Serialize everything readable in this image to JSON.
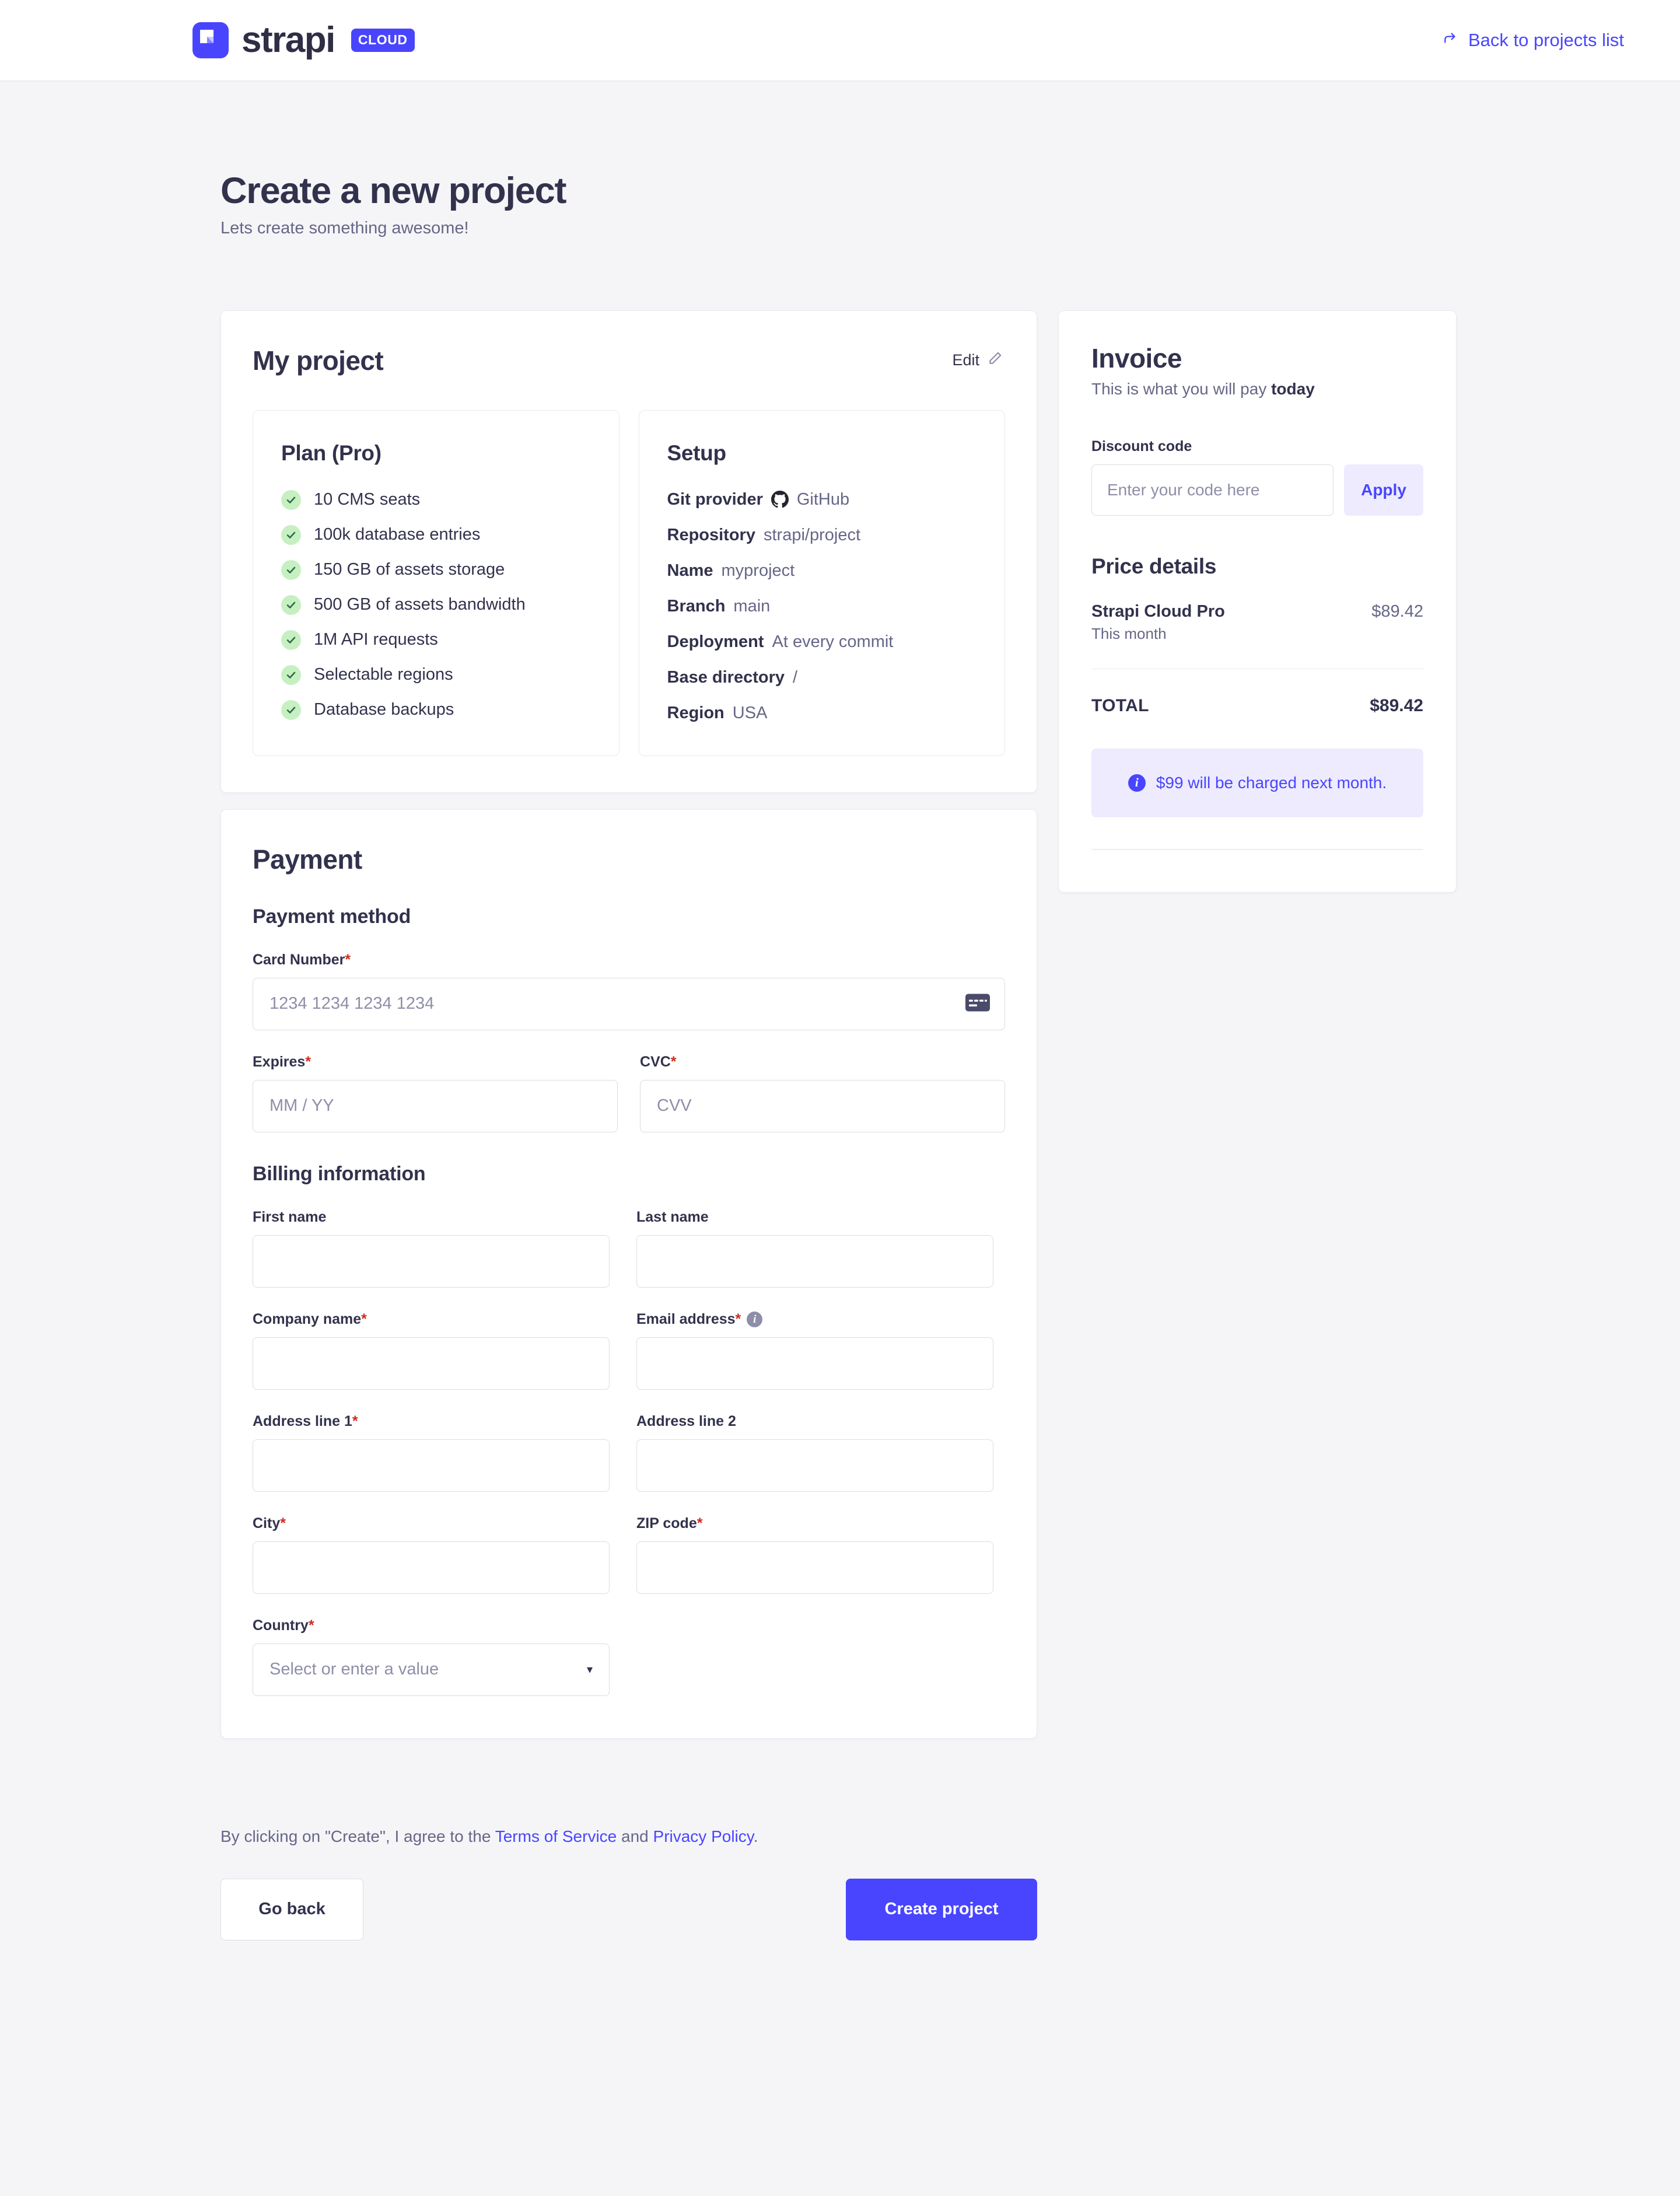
{
  "header": {
    "brand_word": "strapi",
    "brand_badge": "CLOUD",
    "back_link": "Back to projects list"
  },
  "page": {
    "title": "Create a new project",
    "subtitle": "Lets create something awesome!"
  },
  "project": {
    "name": "My project",
    "edit_label": "Edit",
    "plan": {
      "title": "Plan (Pro)",
      "features": [
        "10 CMS seats",
        "100k database entries",
        "150 GB of assets storage",
        "500 GB of assets bandwidth",
        "1M API requests",
        "Selectable regions",
        "Database backups"
      ]
    },
    "setup": {
      "title": "Setup",
      "rows": [
        {
          "key": "Git provider",
          "value": "GitHub",
          "icon": "github-icon"
        },
        {
          "key": "Repository",
          "value": "strapi/project"
        },
        {
          "key": "Name",
          "value": "myproject"
        },
        {
          "key": "Branch",
          "value": "main"
        },
        {
          "key": "Deployment",
          "value": "At every commit"
        },
        {
          "key": "Base directory",
          "value": "/"
        },
        {
          "key": "Region",
          "value": "USA"
        }
      ]
    }
  },
  "payment": {
    "title": "Payment",
    "method_title": "Payment method",
    "card_number": {
      "label": "Card Number",
      "required": "*",
      "placeholder": "1234 1234 1234 1234",
      "value": ""
    },
    "expires": {
      "label": "Expires",
      "required": "*",
      "placeholder": "MM / YY",
      "value": ""
    },
    "cvc": {
      "label": "CVC",
      "required": "*",
      "placeholder": "CVV",
      "value": ""
    },
    "billing_title": "Billing information",
    "first_name": {
      "label": "First name",
      "required": "",
      "placeholder": "",
      "value": ""
    },
    "last_name": {
      "label": "Last name",
      "required": "",
      "placeholder": "",
      "value": ""
    },
    "company_name": {
      "label": "Company name",
      "required": "*",
      "placeholder": "",
      "value": ""
    },
    "email": {
      "label": "Email address",
      "required": "*",
      "placeholder": "",
      "value": "",
      "info": "i"
    },
    "address1": {
      "label": "Address line 1",
      "required": "*",
      "placeholder": "",
      "value": ""
    },
    "address2": {
      "label": "Address line 2",
      "required": "",
      "placeholder": "",
      "value": ""
    },
    "city": {
      "label": "City",
      "required": "*",
      "placeholder": "",
      "value": ""
    },
    "zip": {
      "label": "ZIP code",
      "required": "*",
      "placeholder": "",
      "value": ""
    },
    "country": {
      "label": "Country",
      "required": "*",
      "selected": "Select or enter a value"
    }
  },
  "invoice": {
    "title": "Invoice",
    "subtitle_plain": "This is what you will pay ",
    "subtitle_bold": "today",
    "discount_label": "Discount code",
    "discount_placeholder": "Enter your code here",
    "discount_value": "",
    "apply_label": "Apply",
    "price_title": "Price details",
    "line_name": "Strapi Cloud Pro",
    "line_note": "This month",
    "line_amount": "$89.42",
    "total_label": "TOTAL",
    "total_amount": "$89.42",
    "notice": "$99 will be charged next month."
  },
  "footer": {
    "terms_prefix": "By clicking on \"Create\", I agree to the ",
    "terms_link": "Terms of Service",
    "terms_mid": " and ",
    "privacy_link": "Privacy Policy",
    "terms_suffix": ".",
    "go_back": "Go back",
    "create_project": "Create project"
  },
  "colors": {
    "accent": "#4945ff",
    "accent_soft": "#eeebff",
    "text": "#32324d",
    "muted": "#666687",
    "bg": "#f5f5f8",
    "success": "#c6f0c2",
    "required": "#d02b20"
  }
}
